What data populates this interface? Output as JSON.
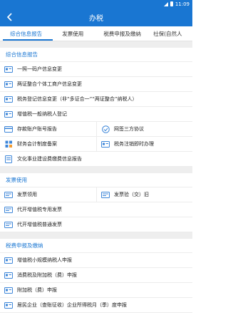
{
  "status_bar": {
    "time": "11:09"
  },
  "app_bar": {
    "title": "办税"
  },
  "tabs": [
    {
      "label": "综合信息报告"
    },
    {
      "label": "发票使用"
    },
    {
      "label": "税费申报及缴纳"
    },
    {
      "label": "社保(自然人"
    }
  ],
  "sections": {
    "comprehensive": {
      "title": "综合信息报告",
      "items": {
        "one_photo": "一照一码户信息变更",
        "two_cert": "两证整合个体工商户信息变更",
        "tax_reg": "税务登记信息变更（非“多证合一”“两证整合”纳税人）",
        "vat_general": "增值税一般纳税人登记",
        "deposit_acct": "存款账户账号报告",
        "three_party": "网签三方协议",
        "accounting": "财务会计制度备案",
        "cancel_now": "税务注销即时办理",
        "culture_fee": "文化事业建设费缴费信息报告"
      }
    },
    "invoice": {
      "title": "发票使用",
      "items": {
        "receive": "发票领用",
        "verify": "发票验（交）旧",
        "special": "代开增值税专用发票",
        "normal": "代开增值税普通发票"
      }
    },
    "declare": {
      "title": "税费申报及缴纳",
      "items": {
        "small_vat": "增值税小规模纳税人申报",
        "consumption": "消费税及附加税（费）申报",
        "surtax": "附加税（费）申报",
        "corp_income": "居民企业（查账征收）企业所得税月（季）度申报"
      }
    }
  },
  "colors": {
    "primary": "#1976d2",
    "icon_blue": "#3d86d8",
    "icon_orange": "#f39c32"
  }
}
